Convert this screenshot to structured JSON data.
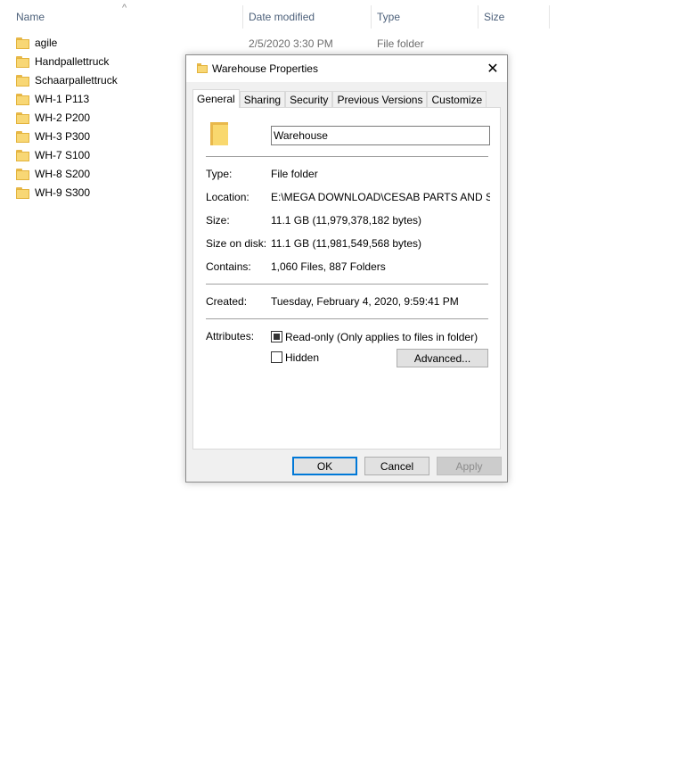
{
  "explorer": {
    "columns": {
      "name": "Name",
      "date_modified": "Date modified",
      "type": "Type",
      "size": "Size"
    },
    "sort_indicator": "^",
    "files": [
      {
        "name": "agile",
        "date": "2/5/2020 3:30 PM",
        "type": "File folder"
      },
      {
        "name": "Handpallettruck"
      },
      {
        "name": "Schaarpallettruck"
      },
      {
        "name": "WH-1 P113"
      },
      {
        "name": "WH-2 P200"
      },
      {
        "name": "WH-3 P300"
      },
      {
        "name": "WH-7 S100"
      },
      {
        "name": "WH-8 S200"
      },
      {
        "name": "WH-9 S300"
      }
    ]
  },
  "dialog": {
    "title": "Warehouse Properties",
    "close_glyph": "✕",
    "tabs": [
      "General",
      "Sharing",
      "Security",
      "Previous Versions",
      "Customize"
    ],
    "active_tab": "General",
    "folder_name": "Warehouse",
    "properties": {
      "type_label": "Type:",
      "type_value": "File folder",
      "location_label": "Location:",
      "location_value": "E:\\MEGA DOWNLOAD\\CESAB PARTS AND SERV",
      "size_label": "Size:",
      "size_value": "11.1 GB (11,979,378,182 bytes)",
      "size_on_disk_label": "Size on disk:",
      "size_on_disk_value": "11.1 GB (11,981,549,568 bytes)",
      "contains_label": "Contains:",
      "contains_value": "1,060 Files, 887 Folders",
      "created_label": "Created:",
      "created_value": "Tuesday, February 4, 2020, 9:59:41 PM",
      "attributes_label": "Attributes:"
    },
    "attributes": {
      "readonly_label": "Read-only (Only applies to files in folder)",
      "readonly_state": "indeterminate",
      "hidden_label": "Hidden",
      "hidden_state": "unchecked",
      "advanced_button": "Advanced..."
    },
    "buttons": {
      "ok": "OK",
      "cancel": "Cancel",
      "apply": "Apply"
    }
  },
  "colors": {
    "accent": "#0078d7",
    "folder": "#f8d775",
    "header_text": "#4c607a"
  },
  "icons": {
    "folder": "folder-icon",
    "close": "close-icon"
  }
}
